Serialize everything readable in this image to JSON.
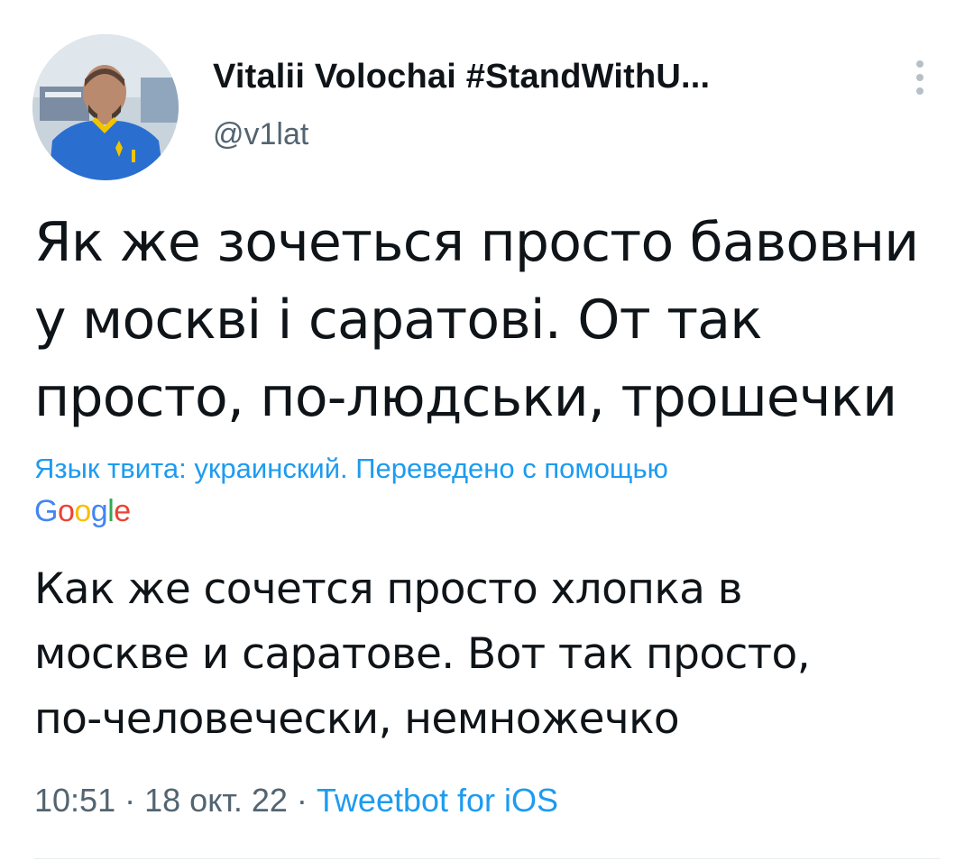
{
  "user": {
    "display_name": "Vitalii Volochai #StandWithU...",
    "handle": "@v1lat",
    "avatar_icon": "user-photo-avatar"
  },
  "tweet": {
    "text_lines": [
      "Як же зочеться просто бавовни",
      "у москві і саратові. От так",
      "просто, по-людськи, трошечки"
    ],
    "translation_note": "Язык твита: украинский. Переведено с помощью",
    "translation_provider": {
      "letters": [
        "G",
        "o",
        "o",
        "g",
        "l",
        "e"
      ],
      "colors": [
        "#4285f4",
        "#ea4335",
        "#fbbc05",
        "#4285f4",
        "#34a853",
        "#ea4335"
      ]
    },
    "translated_lines": [
      "Как же сочется просто хлопка в",
      "москве и саратове. Вот так просто,",
      "по-человечески, немножечко"
    ],
    "time": "10:51",
    "separator": "·",
    "date": "18 окт. 22",
    "source": "Tweetbot for iOS"
  },
  "colors": {
    "text": "#0f1419",
    "secondary": "#536471",
    "link": "#1d9bf0"
  }
}
